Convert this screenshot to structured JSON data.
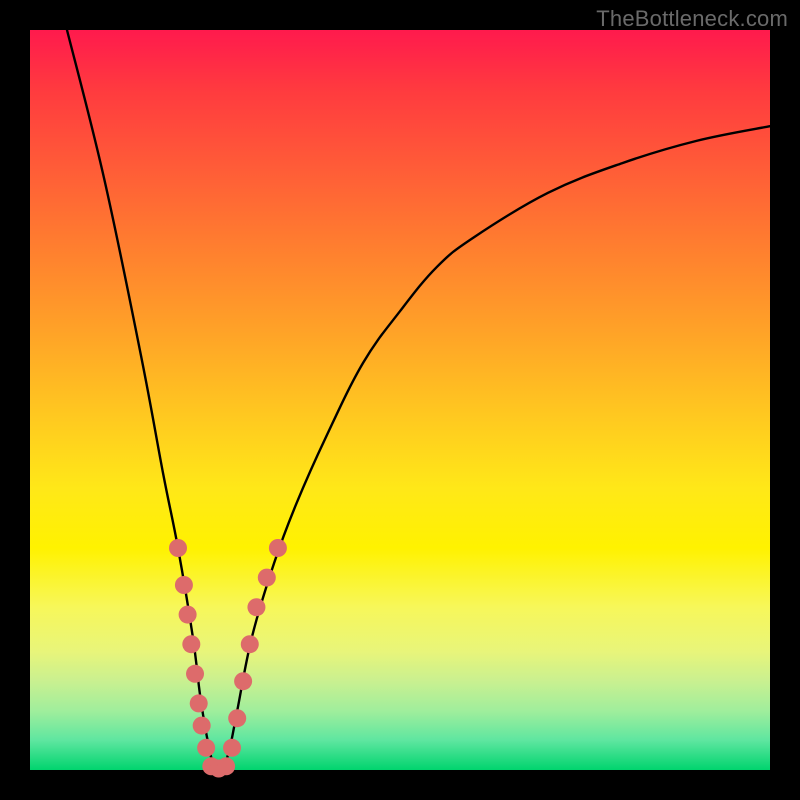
{
  "watermark": "TheBottleneck.com",
  "chart_data": {
    "type": "line",
    "title": "",
    "xlabel": "",
    "ylabel": "",
    "xlim": [
      0,
      100
    ],
    "ylim": [
      0,
      100
    ],
    "grid": false,
    "legend": false,
    "series": [
      {
        "name": "bottleneck-curve",
        "x": [
          5,
          10,
          15,
          18,
          20,
          22,
          23,
          24,
          25,
          26,
          27,
          28,
          30,
          33,
          36,
          40,
          45,
          50,
          55,
          60,
          70,
          80,
          90,
          100
        ],
        "y": [
          100,
          80,
          56,
          40,
          30,
          18,
          10,
          4,
          0,
          0,
          3,
          8,
          18,
          28,
          36,
          45,
          55,
          62,
          68,
          72,
          78,
          82,
          85,
          87
        ]
      }
    ],
    "markers": {
      "name": "salmon-dots",
      "color": "#dd6b6b",
      "points": [
        {
          "x": 20.0,
          "y": 30
        },
        {
          "x": 20.8,
          "y": 25
        },
        {
          "x": 21.3,
          "y": 21
        },
        {
          "x": 21.8,
          "y": 17
        },
        {
          "x": 22.3,
          "y": 13
        },
        {
          "x": 22.8,
          "y": 9
        },
        {
          "x": 23.2,
          "y": 6
        },
        {
          "x": 23.8,
          "y": 3
        },
        {
          "x": 24.5,
          "y": 0.5
        },
        {
          "x": 25.5,
          "y": 0.2
        },
        {
          "x": 26.5,
          "y": 0.5
        },
        {
          "x": 27.3,
          "y": 3
        },
        {
          "x": 28.0,
          "y": 7
        },
        {
          "x": 28.8,
          "y": 12
        },
        {
          "x": 29.7,
          "y": 17
        },
        {
          "x": 30.6,
          "y": 22
        },
        {
          "x": 32.0,
          "y": 26
        },
        {
          "x": 33.5,
          "y": 30
        }
      ]
    }
  }
}
